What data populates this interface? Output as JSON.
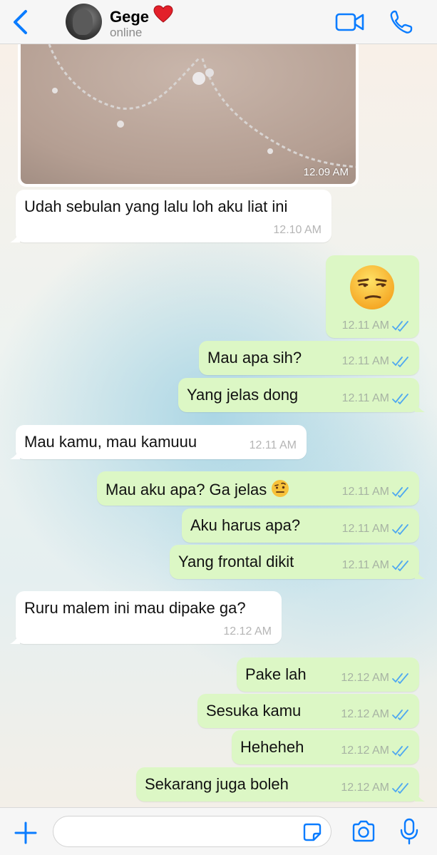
{
  "header": {
    "back_icon": "chevron-left-icon",
    "contact_name": "Gege",
    "name_emoji": "red-heart-icon",
    "status": "online",
    "video_icon": "video-camera-icon",
    "call_icon": "phone-icon"
  },
  "colors": {
    "accent": "#0a7cff",
    "outgoing_bubble": "#dcf7c5",
    "incoming_bubble": "#ffffff",
    "read_ticks": "#4fa8f0"
  },
  "messages": [
    {
      "id": "m0",
      "type": "image",
      "direction": "in",
      "time": "12.09 AM"
    },
    {
      "id": "m1",
      "direction": "in",
      "text": "Udah sebulan yang lalu loh aku liat ini",
      "time": "12.10 AM"
    },
    {
      "id": "m2",
      "direction": "out",
      "type": "emoji",
      "emoji": "unamused-face-icon",
      "time": "12.11 AM",
      "read": true
    },
    {
      "id": "m3",
      "direction": "out",
      "text": "Mau apa sih?",
      "time": "12.11 AM",
      "read": true
    },
    {
      "id": "m4",
      "direction": "out",
      "text": "Yang jelas dong",
      "time": "12.11 AM",
      "read": true
    },
    {
      "id": "m5",
      "direction": "in",
      "text": "Mau kamu, mau kamuuu",
      "time": "12.11 AM"
    },
    {
      "id": "m6",
      "direction": "out",
      "text": "Mau aku apa? Ga jelas",
      "emoji": "face-with-raised-eyebrow-icon",
      "time": "12.11 AM",
      "read": true
    },
    {
      "id": "m7",
      "direction": "out",
      "text": "Aku harus apa?",
      "time": "12.11 AM",
      "read": true
    },
    {
      "id": "m8",
      "direction": "out",
      "text": "Yang frontal dikit",
      "time": "12.11 AM",
      "read": true
    },
    {
      "id": "m9",
      "direction": "in",
      "text": "Ruru malem ini mau dipake ga?",
      "time": "12.12 AM"
    },
    {
      "id": "m10",
      "direction": "out",
      "text": "Pake lah",
      "time": "12.12 AM",
      "read": true
    },
    {
      "id": "m11",
      "direction": "out",
      "text": "Sesuka kamu",
      "time": "12.12 AM",
      "read": true
    },
    {
      "id": "m12",
      "direction": "out",
      "text": "Heheheh",
      "time": "12.12 AM",
      "read": true
    },
    {
      "id": "m13",
      "direction": "out",
      "text": "Sekarang juga boleh",
      "time": "12.12 AM",
      "read": true
    }
  ],
  "composer": {
    "input_value": "",
    "placeholder": "",
    "plus_icon": "plus-icon",
    "sticker_icon": "sticker-icon",
    "camera_icon": "camera-icon",
    "mic_icon": "microphone-icon"
  }
}
